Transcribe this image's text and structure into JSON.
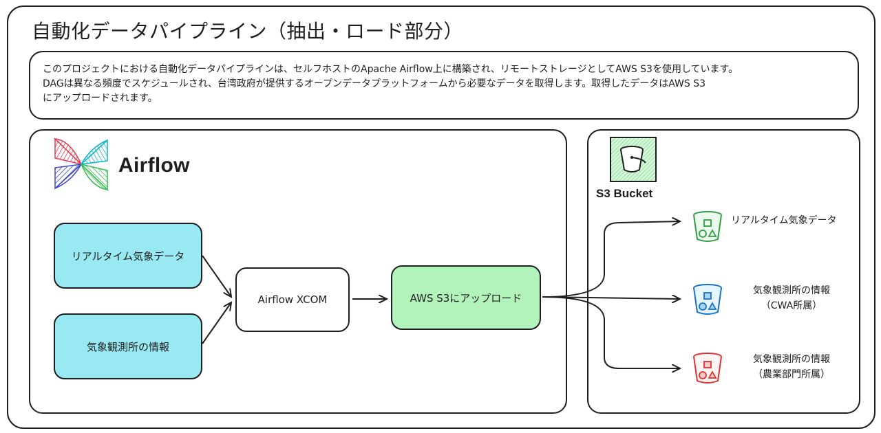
{
  "title": "自動化データパイプライン（抽出・ロード部分）",
  "description": {
    "lines": [
      "このプロジェクトにおける自動化データパイプラインは、セルフホストのApache Airflow上に構築され、リモートストレージとしてAWS S3を使用しています。",
      "DAGは異なる頻度でスケジュールされ、台湾政府が提供するオープンデータプラットフォームから必要なデータを取得します。取得したデータはAWS S3",
      "にアップロードされます。"
    ]
  },
  "airflow": {
    "logo_name": "airflow-pinwheel-icon",
    "label": "Airflow",
    "sources": {
      "realtime": "リアルタイム気象データ",
      "station": "気象観測所の情報"
    },
    "xcom": "Airflow XCOM",
    "upload": "AWS S3にアップロード"
  },
  "s3": {
    "icon_name": "s3-bucket-icon",
    "label": "S3 Bucket",
    "buckets": [
      {
        "line1": "リアルタイム気象データ",
        "line2": "",
        "color": "#2f9e44",
        "fill": "#ebfbee"
      },
      {
        "line1": "気象観測所の情報",
        "line2": "（CWA所属）",
        "color": "#1971c2",
        "fill": "#e7f5ff"
      },
      {
        "line1": "気象観測所の情報",
        "line2": "（農業部門所属）",
        "color": "#e03131",
        "fill": "#fff5f5"
      }
    ]
  },
  "colors": {
    "source_fill": "#99e9f2",
    "upload_fill": "#b2f2bb",
    "stroke": "#1e1e1e"
  }
}
